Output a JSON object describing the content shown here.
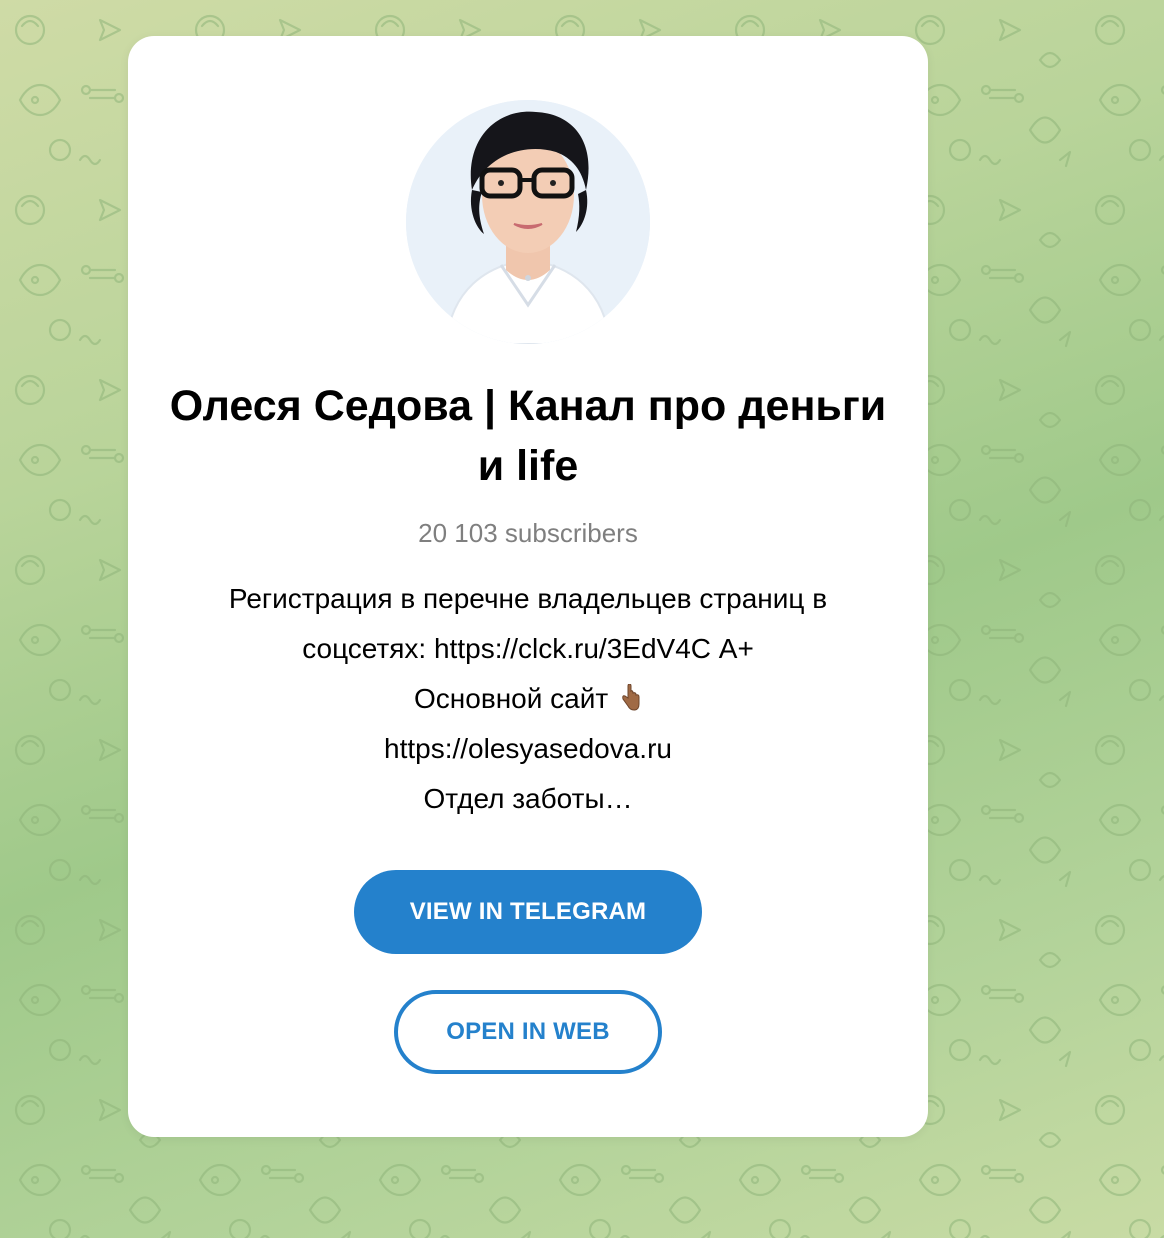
{
  "channel": {
    "title": "Олеся Седова | Канал про деньги и life",
    "subscribers": "20 103 subscribers",
    "description_lines": [
      "Регистрация в перечне владельцев страниц в",
      "соцсетях: https://clck.ru/3EdV4C А+",
      "Основной сайт",
      "https://olesyasedova.ru",
      "Отдел заботы…"
    ],
    "description_emoji": "pointing-down-hand-icon"
  },
  "buttons": {
    "view_in_telegram": "VIEW IN TELEGRAM",
    "open_in_web": "OPEN IN WEB"
  },
  "colors": {
    "accent": "#2481cc",
    "background": "#b9d49a",
    "subtitle": "#7f7f7f"
  }
}
